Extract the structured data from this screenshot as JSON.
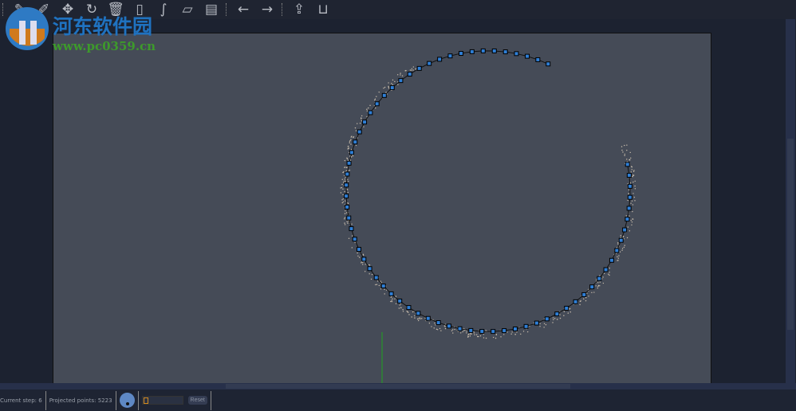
{
  "toolbar": {
    "icons": [
      "new-icon",
      "edit-icon",
      "move-icon",
      "rotate-icon",
      "delete-icon",
      "frame-icon",
      "lasso-icon",
      "plane-icon",
      "layers-icon",
      "arrow-left-icon",
      "arrow-right-icon",
      "export-icon",
      "inbox-icon"
    ]
  },
  "watermark": {
    "title": "河东软件园",
    "url": "www.pc0359.cn"
  },
  "status": {
    "current_step": "Current step: 6",
    "projected_points": "Projected points: 5223",
    "reset_label": "Reset",
    "slider_value": 0
  },
  "colors": {
    "canvas": "#454b57",
    "point": "#2f7fd6",
    "axis": "#1fa51f"
  }
}
